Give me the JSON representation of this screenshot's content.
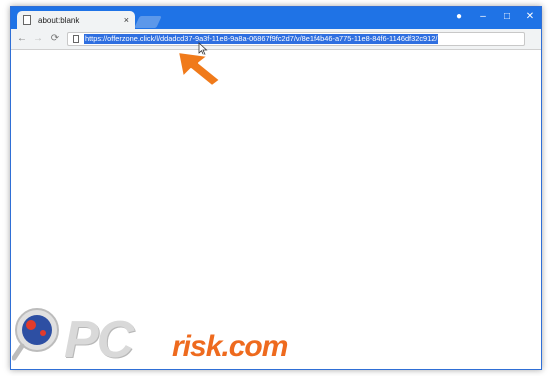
{
  "tab": {
    "title": "about:blank",
    "close_glyph": "×"
  },
  "window_controls": {
    "profile": "●",
    "minimize": "–",
    "maximize": "□",
    "close": "✕"
  },
  "nav": {
    "back": "←",
    "forward": "→",
    "reload": "⟳"
  },
  "omnibox": {
    "url": "https://offerzone.click/l/ddadcd37-9a3f-11e8-9a8a-06867f9fc2d7/v/8e1f4b46-a775-11e8-84f6-1146df32c912/"
  },
  "watermark": {
    "pc": "PC",
    "risk": "risk.com"
  },
  "colors": {
    "titlebar": "#1f73e6",
    "url_highlight": "#2f6fe0",
    "arrow": "#f07a1a",
    "logo_orange": "#ee6a1e"
  }
}
